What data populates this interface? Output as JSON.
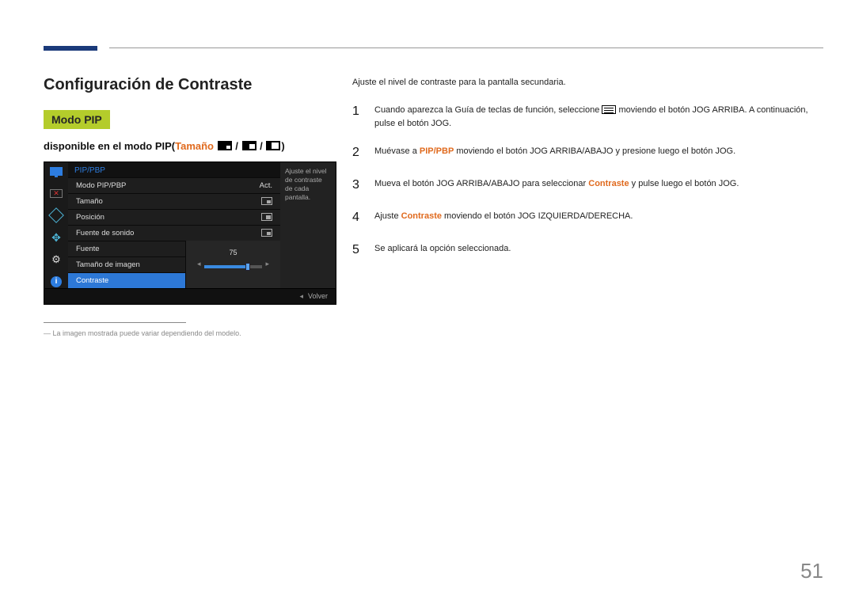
{
  "page_number": "51",
  "heading": "Configuración de Contraste",
  "mode_badge": "Modo PIP",
  "subhead_prefix": "disponible en el modo PIP(",
  "subhead_orange": "Tamaño",
  "subhead_suffix_sep": " / ",
  "subhead_close": ")",
  "osd": {
    "title": "PIP/PBP",
    "rows": {
      "r1": {
        "label": "Modo PIP/PBP",
        "value": "Act."
      },
      "r2": {
        "label": "Tamaño"
      },
      "r3": {
        "label": "Posición"
      },
      "r4": {
        "label": "Fuente de sonido"
      },
      "r5": {
        "label": "Fuente"
      },
      "r6": {
        "label": "Tamaño de imagen"
      },
      "r7": {
        "label": "Contraste"
      }
    },
    "slider_value": "75",
    "help_text": "Ajuste el nivel de contraste de cada pantalla.",
    "footer_back": "Volver"
  },
  "footnote_marker": "―",
  "footnote": "La imagen mostrada puede variar dependiendo del modelo.",
  "intro": "Ajuste el nivel de contraste para la pantalla secundaria.",
  "steps": {
    "s1": {
      "num": "1",
      "pre": "Cuando aparezca la Guía de teclas de función, seleccione ",
      "post": " moviendo el botón JOG ARRIBA. A continuación, pulse el botón JOG."
    },
    "s2": {
      "num": "2",
      "pre": "Muévase a ",
      "kw": "PIP/PBP",
      "post": " moviendo el botón JOG ARRIBA/ABAJO y presione luego el botón JOG."
    },
    "s3": {
      "num": "3",
      "pre": "Mueva el botón JOG ARRIBA/ABAJO para seleccionar ",
      "kw": "Contraste",
      "post": " y pulse luego el botón JOG."
    },
    "s4": {
      "num": "4",
      "pre": "Ajuste ",
      "kw": "Contraste",
      "post": " moviendo el botón JOG IZQUIERDA/DERECHA."
    },
    "s5": {
      "num": "5",
      "txt": "Se aplicará la opción seleccionada."
    }
  },
  "chart_data": {
    "type": "bar",
    "title": "Contraste",
    "categories": [
      "Contraste"
    ],
    "values": [
      75
    ],
    "ylim": [
      0,
      100
    ],
    "xlabel": "",
    "ylabel": ""
  }
}
